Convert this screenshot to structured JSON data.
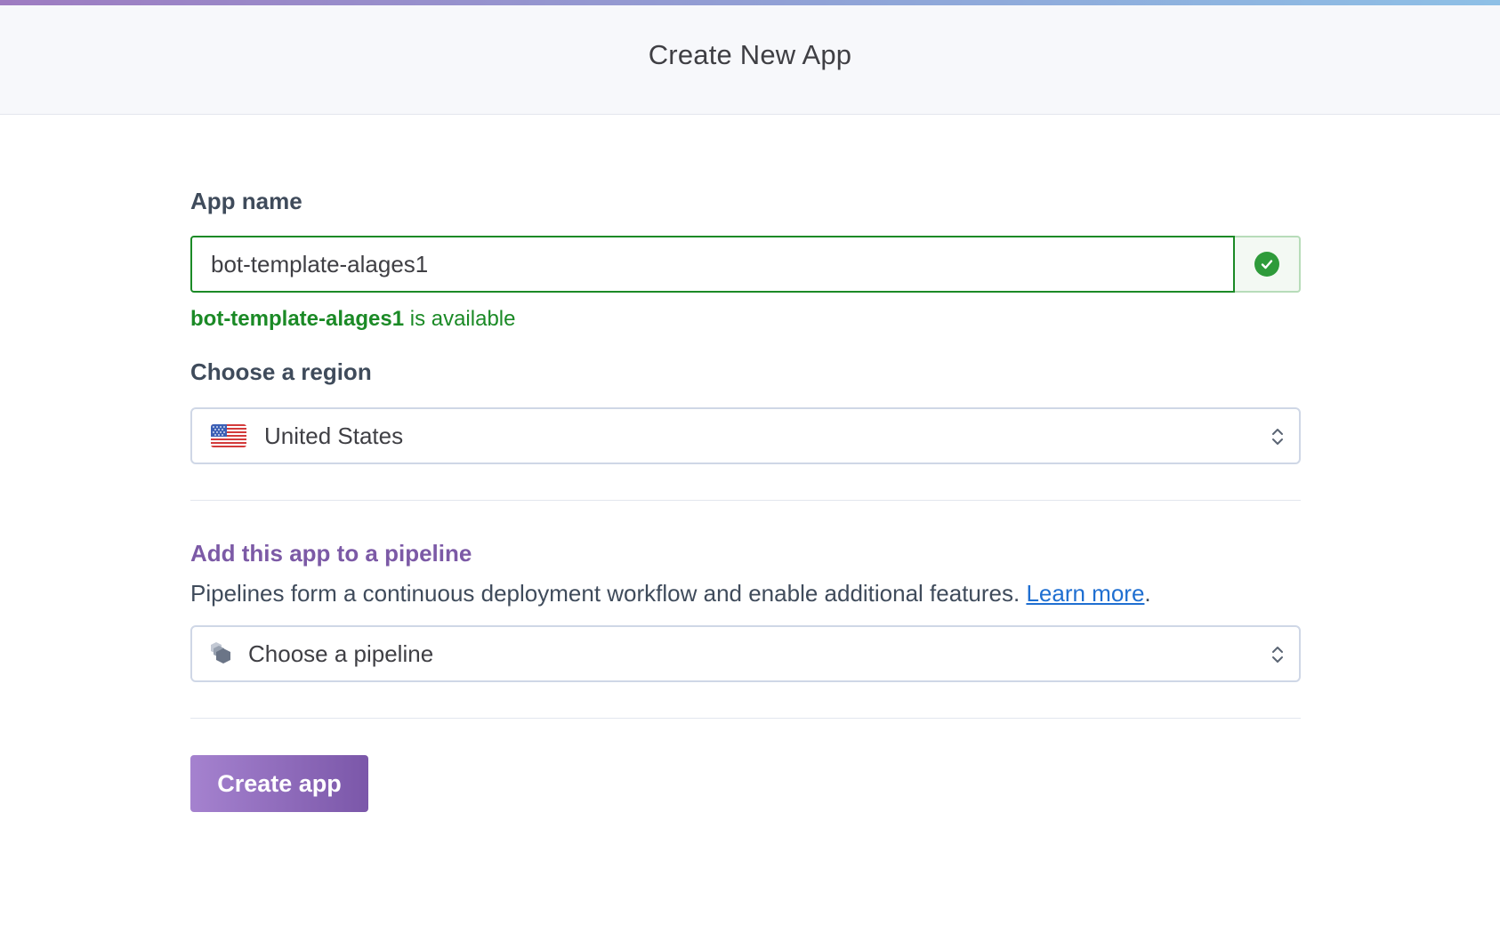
{
  "header": {
    "title": "Create New App"
  },
  "app_name": {
    "label": "App name",
    "value": "bot-template-alages1",
    "status_name": "bot-template-alages1",
    "status_suffix": " is available",
    "status_icon": "check-circle-icon"
  },
  "region": {
    "label": "Choose a region",
    "selected": "United States",
    "flag_icon": "us-flag-icon"
  },
  "pipeline": {
    "heading": "Add this app to a pipeline",
    "description": "Pipelines form a continuous deployment workflow and enable additional features. ",
    "learn_more": "Learn more",
    "description_end": ".",
    "placeholder": "Choose a pipeline",
    "icon": "pipeline-hexagons-icon"
  },
  "actions": {
    "create_label": "Create app"
  },
  "colors": {
    "accent_purple": "#7c5aa6",
    "success_green": "#1b8a26",
    "link_blue": "#1f6fd1"
  }
}
